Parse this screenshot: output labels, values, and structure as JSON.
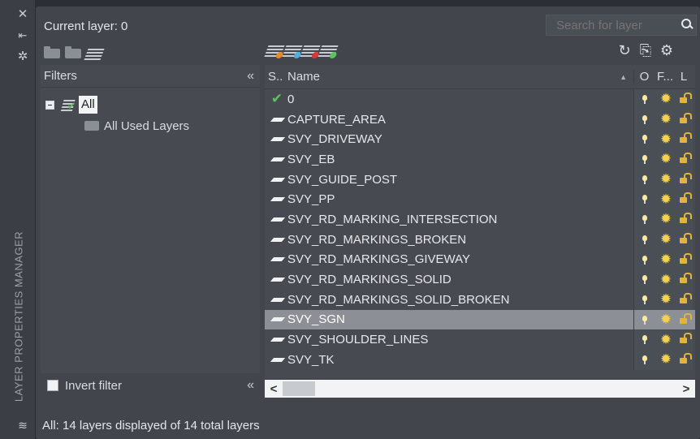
{
  "palette": {
    "title": "LAYER PROPERTIES MANAGER",
    "close_icon": "close-icon",
    "pin_icon": "auto-hide-icon",
    "props_icon": "properties-icon"
  },
  "header": {
    "current_layer": "Current layer: 0",
    "search_placeholder": "Search for layer"
  },
  "filters": {
    "title": "Filters",
    "tree": [
      {
        "label": "All",
        "selected": true
      },
      {
        "label": "All Used Layers"
      }
    ],
    "invert_label": "Invert filter",
    "invert_checked": false
  },
  "layer_list": {
    "columns": [
      "S..",
      "Name",
      "O",
      "F...",
      "L"
    ],
    "rows": [
      {
        "name": "0",
        "status": "current"
      },
      {
        "name": "CAPTURE_AREA"
      },
      {
        "name": "SVY_DRIVEWAY"
      },
      {
        "name": "SVY_EB"
      },
      {
        "name": "SVY_GUIDE_POST"
      },
      {
        "name": "SVY_PP"
      },
      {
        "name": "SVY_RD_MARKING_INTERSECTION"
      },
      {
        "name": "SVY_RD_MARKINGS_BROKEN"
      },
      {
        "name": "SVY_RD_MARKINGS_GIVEWAY"
      },
      {
        "name": "SVY_RD_MARKINGS_SOLID"
      },
      {
        "name": "SVY_RD_MARKINGS_SOLID_BROKEN"
      },
      {
        "name": "SVY_SGN",
        "selected": true
      },
      {
        "name": "SVY_SHOULDER_LINES"
      },
      {
        "name": "SVY_TK"
      }
    ]
  },
  "scroll": {
    "left": "<",
    "right": ">"
  },
  "status": "All: 14 layers displayed of 14 total layers"
}
